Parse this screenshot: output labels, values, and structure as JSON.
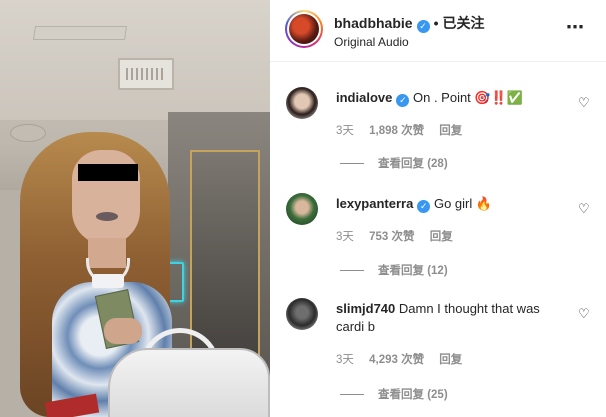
{
  "post": {
    "username": "bhadbhabie",
    "separator": "•",
    "follow_state": "已关注",
    "audio": "Original Audio",
    "more_icon": "⋯"
  },
  "comments": [
    {
      "username": "indialove",
      "text": "On . Point 🎯‼️✅",
      "time": "3天",
      "likes": "1,898 次赞",
      "reply": "回复",
      "view_replies": "查看回复 (28)"
    },
    {
      "username": "lexypanterra",
      "text": "Go girl 🔥",
      "time": "3天",
      "likes": "753 次赞",
      "reply": "回复",
      "view_replies": "查看回复 (12)"
    },
    {
      "username": "slimjd740",
      "text": "Damn I thought that was cardi b",
      "time": "3天",
      "likes": "4,293 次赞",
      "reply": "回复",
      "view_replies": "查看回复 (25)"
    }
  ],
  "colors": {
    "verified": "#3897f0",
    "muted": "#8e8e8e",
    "text": "#262626"
  }
}
